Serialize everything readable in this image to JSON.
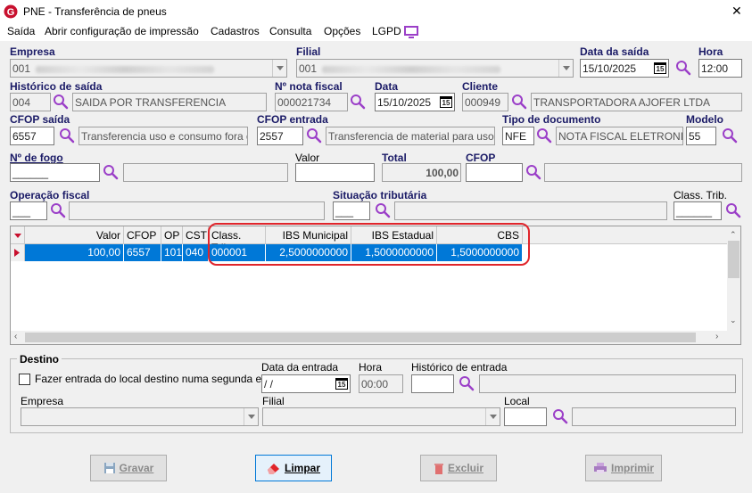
{
  "window": {
    "title": "PNE - Transferência de pneus",
    "close": "✕"
  },
  "menu": [
    "Saída",
    "Abrir configuração de impressão",
    "Cadastros",
    "Consulta",
    "Opções",
    "LGPD"
  ],
  "form": {
    "empresa": {
      "label": "Empresa",
      "value": "001"
    },
    "filial": {
      "label": "Filial",
      "value": "001"
    },
    "data_saida": {
      "label": "Data da saída",
      "value": "15/10/2025"
    },
    "hora": {
      "label": "Hora",
      "value": "12:00"
    },
    "historico_saida": {
      "label": "Histórico de saída",
      "code": "004",
      "desc": "SAIDA POR TRANSFERENCIA"
    },
    "nota_fiscal": {
      "label": "Nº nota fiscal",
      "value": "000021734"
    },
    "data": {
      "label": "Data",
      "value": "15/10/2025"
    },
    "cliente": {
      "label": "Cliente",
      "code": "000949",
      "desc": "TRANSPORTADORA AJOFER LTDA"
    },
    "cfop_saida": {
      "label": "CFOP saída",
      "code": "6557",
      "desc": "Transferencia uso e consumo fora do E"
    },
    "cfop_entrada": {
      "label": "CFOP entrada",
      "code": "2557",
      "desc": "Transferencia de material para uso e co"
    },
    "tipo_documento": {
      "label": "Tipo de documento",
      "code": "NFE",
      "desc": "NOTA FISCAL ELETRONICA"
    },
    "modelo": {
      "label": "Modelo",
      "value": "55"
    },
    "n_fogo": {
      "label": "Nº de fogo",
      "value": "______"
    },
    "valor": {
      "label": "Valor",
      "value": ""
    },
    "total": {
      "label": "Total",
      "value": "100,00"
    },
    "cfop": {
      "label": "CFOP",
      "value": ""
    },
    "operacao_fiscal": {
      "label": "Operação fiscal",
      "value": "___"
    },
    "situacao_tributaria": {
      "label": "Situação tributária",
      "value": "___"
    },
    "class_trib": {
      "label": "Class. Trib.",
      "value": "______"
    }
  },
  "grid": {
    "columns": [
      "Valor",
      "CFOP",
      "OP",
      "CST",
      "Class. Trib.",
      "IBS Municipal",
      "IBS Estadual",
      "CBS"
    ],
    "rows": [
      [
        "100,00",
        "6557",
        "101",
        "040",
        "000001",
        "2,5000000000",
        "1,5000000000",
        "1,5000000000"
      ]
    ]
  },
  "destino": {
    "title": "Destino",
    "checkbox_label": "Fazer entrada do local destino numa segunda etapa",
    "data_entrada": {
      "label": "Data da entrada",
      "value": " / /"
    },
    "hora": {
      "label": "Hora",
      "value": "00:00"
    },
    "historico_entrada": {
      "label": "Histórico de entrada",
      "value": ""
    },
    "empresa": {
      "label": "Empresa",
      "value": ""
    },
    "filial": {
      "label": "Filial",
      "value": ""
    },
    "local": {
      "label": "Local",
      "value": ""
    }
  },
  "buttons": {
    "gravar": "Gravar",
    "limpar": "Limpar",
    "excluir": "Excluir",
    "imprimir": "Imprimir"
  },
  "colors": {
    "label_blue": "#1a1a66",
    "selection": "#0078d7",
    "highlight_ring": "#e0252b",
    "lookup_icon": "#9b3fc8"
  }
}
